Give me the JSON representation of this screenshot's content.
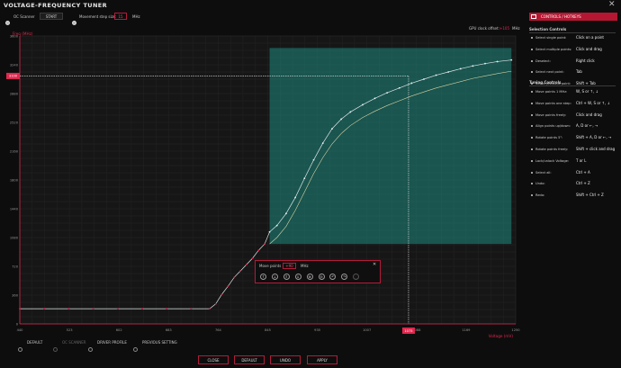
{
  "window": {
    "title": "VOLTAGE-FREQUENCY TUNER",
    "close_glyph": "✕"
  },
  "top_bar": {
    "oc_scanner_label": "OC Scanner",
    "start_label": "START",
    "movement_step_label": "Movement step size:",
    "movement_step_value": "15",
    "movement_step_unit": "MHz",
    "gpu_offset_label": "GPU clock offset:",
    "gpu_offset_value": "+105",
    "gpu_offset_unit": "MHz"
  },
  "colors": {
    "accent": "#e0284f",
    "selection": "#1f8a80",
    "curve": "#cfe8ec",
    "original": "#d8d2a0",
    "grid": "#242424"
  },
  "chart_data": {
    "type": "line",
    "ylabel": "Freq (MHz)",
    "xlabel": "Voltage (mV)",
    "x_ticks": [
      "440",
      "523",
      "602",
      "683",
      "764",
      "845",
      "935",
      "1007",
      "1088",
      "1169",
      "1250"
    ],
    "y_ticks": [
      "0",
      "360",
      "720",
      "1080",
      "1440",
      "1800",
      "2160",
      "2520",
      "2880",
      "3240",
      "3600"
    ],
    "xlim": [
      440,
      1250
    ],
    "ylim": [
      0,
      3600
    ],
    "y_marker": "3100",
    "x_marker": "1075",
    "selection_box": {
      "x": [
        848,
        1243
      ],
      "y": [
        1000,
        3450
      ]
    },
    "series": [
      {
        "points": [
          [
            440,
            190
          ],
          [
            480,
            190
          ],
          [
            520,
            190
          ],
          [
            560,
            190
          ],
          [
            600,
            190
          ],
          [
            640,
            190
          ],
          [
            680,
            190
          ],
          [
            720,
            190
          ],
          [
            750,
            190
          ],
          [
            760,
            250
          ],
          [
            770,
            370
          ],
          [
            780,
            470
          ],
          [
            790,
            580
          ],
          [
            800,
            660
          ],
          [
            810,
            740
          ],
          [
            820,
            820
          ],
          [
            830,
            920
          ],
          [
            840,
            1000
          ],
          [
            848,
            1150
          ],
          [
            860,
            1230
          ],
          [
            875,
            1380
          ],
          [
            890,
            1580
          ],
          [
            905,
            1820
          ],
          [
            920,
            2050
          ],
          [
            935,
            2260
          ],
          [
            950,
            2440
          ],
          [
            965,
            2560
          ],
          [
            980,
            2650
          ],
          [
            1000,
            2740
          ],
          [
            1020,
            2820
          ],
          [
            1040,
            2890
          ],
          [
            1060,
            2950
          ],
          [
            1080,
            3010
          ],
          [
            1100,
            3060
          ],
          [
            1120,
            3110
          ],
          [
            1140,
            3150
          ],
          [
            1160,
            3190
          ],
          [
            1180,
            3225
          ],
          [
            1200,
            3255
          ],
          [
            1220,
            3280
          ],
          [
            1243,
            3300
          ]
        ]
      },
      {
        "points": [
          [
            848,
            1000
          ],
          [
            860,
            1080
          ],
          [
            875,
            1220
          ],
          [
            890,
            1420
          ],
          [
            905,
            1650
          ],
          [
            920,
            1880
          ],
          [
            935,
            2080
          ],
          [
            950,
            2250
          ],
          [
            965,
            2380
          ],
          [
            980,
            2480
          ],
          [
            1000,
            2580
          ],
          [
            1020,
            2660
          ],
          [
            1040,
            2730
          ],
          [
            1060,
            2790
          ],
          [
            1080,
            2850
          ],
          [
            1100,
            2900
          ],
          [
            1120,
            2950
          ],
          [
            1140,
            2990
          ],
          [
            1160,
            3030
          ],
          [
            1180,
            3070
          ],
          [
            1200,
            3100
          ],
          [
            1220,
            3130
          ],
          [
            1243,
            3160
          ]
        ]
      }
    ]
  },
  "move_panel": {
    "label": "Move points",
    "value": "+90",
    "unit": "MHz",
    "close_glyph": "✕",
    "buttons": [
      {
        "glyph": "↑"
      },
      {
        "glyph": "↓"
      },
      {
        "glyph": "⇑"
      },
      {
        "glyph": "⇓"
      },
      {
        "glyph": "⊕"
      },
      {
        "glyph": "⊖"
      },
      {
        "glyph": "↶"
      },
      {
        "glyph": "↷"
      },
      {
        "glyph": "◌"
      }
    ]
  },
  "sidebar": {
    "header": "CONTROLS / HOTKEYS",
    "selection_title": "Selection Controls",
    "selection_items": [
      {
        "label": "Select single point:",
        "key": "Click on a point"
      },
      {
        "label": "Select multiple points:",
        "key": "Click and drag"
      },
      {
        "label": "Deselect:",
        "key": "Right click"
      },
      {
        "label": "Select next point:",
        "key": "Tab"
      },
      {
        "label": "Select previous point:",
        "key": "Shift + Tab"
      }
    ],
    "tuning_title": "Tuning Controls",
    "tuning_items": [
      {
        "label": "Move points 1 MHz:",
        "key": "W, S or ↑, ↓"
      },
      {
        "label": "Move points one step:",
        "key": "Ctrl + W, S or ↑, ↓"
      },
      {
        "label": "Move points freely:",
        "key": "Click and drag"
      },
      {
        "label": "Align points up/down:",
        "key": "A, D or ←, →"
      },
      {
        "label": "Rotate points 5°:",
        "key": "Shift + A, D or ←, →"
      },
      {
        "label": "Rotate points freely:",
        "key": "Shift + click and drag"
      },
      {
        "label": "Lock/unlock Voltage:",
        "key": "T or L"
      },
      {
        "label": "Select all:",
        "key": "Ctrl + A"
      },
      {
        "label": "Undo:",
        "key": "Ctrl + Z"
      },
      {
        "label": "Redo:",
        "key": "Shift + Ctrl + Z"
      }
    ]
  },
  "options": [
    {
      "label": "DEFAULT",
      "selected": false,
      "disabled": false
    },
    {
      "label": "OC SCANNER",
      "selected": false,
      "disabled": true
    },
    {
      "label": "DRIVER PROFILE",
      "selected": false,
      "disabled": false
    },
    {
      "label": "PREVIOUS SETTING",
      "selected": false,
      "disabled": false
    }
  ],
  "buttons": {
    "close": "CLOSE",
    "default": "DEFAULT",
    "undo": "UNDO",
    "apply": "APPLY"
  }
}
